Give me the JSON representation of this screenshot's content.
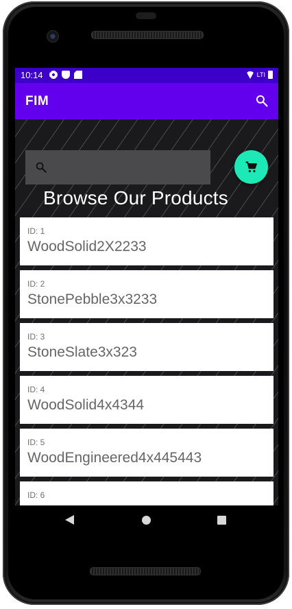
{
  "status_bar": {
    "time": "10:14",
    "network": "LTI",
    "icons": [
      "gear-icon",
      "shield-icon",
      "sdcard-icon",
      "wifi-icon",
      "battery-icon"
    ]
  },
  "app_bar": {
    "title": "FIM",
    "search_icon": "search-icon",
    "background": "#6200ee"
  },
  "search": {
    "value": "",
    "placeholder": "",
    "icon": "search-icon"
  },
  "cart_button": {
    "icon": "shopping-cart-icon",
    "color": "#1de9b6"
  },
  "heading": "Browse Our Products",
  "products": [
    {
      "id": "ID: 1",
      "name": "WoodSolid2X2233"
    },
    {
      "id": "ID: 2",
      "name": "StonePebble3x3233"
    },
    {
      "id": "ID: 3",
      "name": "StoneSlate3x323"
    },
    {
      "id": "ID: 4",
      "name": "WoodSolid4x4344"
    },
    {
      "id": "ID: 5",
      "name": "WoodEngineered4x445443"
    },
    {
      "id": "ID: 6",
      "name": ""
    }
  ],
  "nav": {
    "back": "back-icon",
    "home": "home-icon",
    "recents": "recents-icon"
  },
  "colors": {
    "status_bar": "#3d00c8",
    "accent": "#1de9b6",
    "primary": "#6200ee"
  }
}
